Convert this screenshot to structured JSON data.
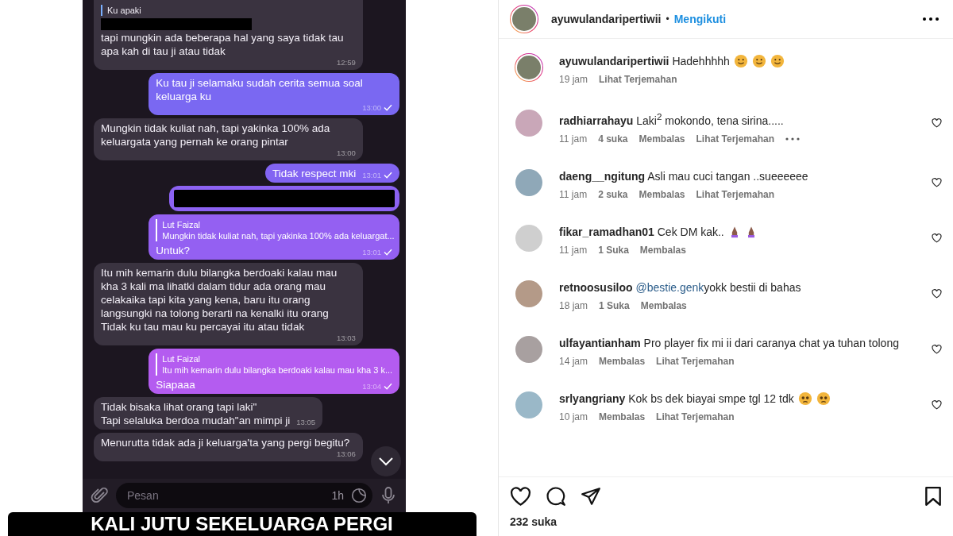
{
  "chat": {
    "messages": [
      {
        "outgoing": false,
        "kind": "reply",
        "quote_text": "Ku apaki",
        "redacted": true,
        "text": "tapi mungkin ada beberapa hal yang saya tidak tau apa kah di tau ji atau tidak",
        "time": "12:59"
      },
      {
        "outgoing": true,
        "kind": "text",
        "color": "#7a68f2",
        "text": "Ku tau ji selamaku sudah cerita semua soal keluarga ku",
        "time": "13:00"
      },
      {
        "outgoing": false,
        "kind": "text",
        "text": "Mungkin tidak kuliat nah, tapi yakinka 100% ada keluargata yang pernah ke orang pintar",
        "time": "13:00"
      },
      {
        "outgoing": true,
        "kind": "text",
        "color": "#8264f2",
        "text": "Tidak respect mki",
        "time": "13:01"
      },
      {
        "outgoing": true,
        "kind": "redacted",
        "color": "#8c62f2"
      },
      {
        "outgoing": true,
        "kind": "reply",
        "color": "#9460f2",
        "quote_name": "Lut Faizal",
        "quote_text": "Mungkin tidak kuliat nah, tapi yakinka 100% ada keluargat...",
        "text": "Untuk?",
        "time": "13:01"
      },
      {
        "outgoing": false,
        "kind": "text",
        "text": "Itu mih kemarin dulu bilangka berdoaki kalau mau kha 3 kali ma lihatki dalam tidur ada orang mau celakaika tapi kita yang kena, baru itu orang langsungki na tolong berarti na kenalki itu orang\nTidak ku tau mau ku percayai itu atau tidak",
        "time": "13:03"
      },
      {
        "outgoing": true,
        "kind": "reply",
        "color": "#b45cf0",
        "quote_name": "Lut Faizal",
        "quote_text": "Itu mih kemarin dulu bilangka berdoaki kalau mau kha 3 k...",
        "text": "Siapaaa",
        "time": "13:04"
      },
      {
        "outgoing": false,
        "kind": "text",
        "text": "Tidak bisaka lihat orang tapi laki\"\nTapi selaluka berdoa mudah\"an mimpi ji",
        "time": "13:05"
      },
      {
        "outgoing": false,
        "kind": "text",
        "text": "Menurutta tidak ada ji keluarga'ta yang pergi begitu?",
        "time": "13:06"
      }
    ],
    "input": {
      "placeholder": "Pesan",
      "timer": "1h"
    }
  },
  "caption_banner": "KALI JUTU SEKELUARGA PERGI",
  "post_header": {
    "username": "ayuwulandaripertiwii",
    "separator": "•",
    "follow": "Mengikuti"
  },
  "comments": [
    {
      "kind": "caption",
      "user": "ayuwulandaripertiwii",
      "text": "Hadehhhhh",
      "emojis": [
        {
          "kind": "smile"
        },
        {
          "kind": "smile"
        },
        {
          "kind": "smile"
        }
      ],
      "time": "19 jam",
      "translate": "Lihat Terjemahan"
    },
    {
      "kind": "comment",
      "user": "radhiarrahayu",
      "text": "Laki$^{2}$ mokondo, tena sirina.....",
      "time": "11 jam",
      "likes": "4 suka",
      "reply": "Membalas",
      "translate": "Lihat Terjemahan",
      "more": true
    },
    {
      "kind": "comment",
      "user": "daeng__ngitung",
      "text": "Asli mau cuci tangan ..sueeeeee",
      "time": "11 jam",
      "likes": "2 suka",
      "reply": "Membalas",
      "translate": "Lihat Terjemahan"
    },
    {
      "kind": "comment",
      "user": "fikar_ramadhan01",
      "text": "Cek DM kak..",
      "emojis": [
        {
          "kind": "pray"
        },
        {
          "kind": "pray"
        }
      ],
      "time": "11 jam",
      "likes": "1 Suka",
      "reply": "Membalas"
    },
    {
      "kind": "comment",
      "user": "retnoosusiloo",
      "mention": "@bestie.genk",
      "text": "yokk bestii di bahas",
      "time": "18 jam",
      "likes": "1 Suka",
      "reply": "Membalas"
    },
    {
      "kind": "comment",
      "user": "ulfayantianham",
      "text": "Pro player fix mi ii dari caranya chat ya tuhan tolong",
      "time": "14 jam",
      "reply": "Membalas",
      "translate": "Lihat Terjemahan"
    },
    {
      "kind": "comment",
      "user": "srlyangriany",
      "text": "Kok bs dek biayai smpe tgl 12 tdk",
      "emojis": [
        {
          "kind": "pleading"
        },
        {
          "kind": "pleading"
        }
      ],
      "time": "10 jam",
      "reply": "Membalas",
      "translate": "Lihat Terjemahan"
    }
  ],
  "likes_count": "232 suka"
}
